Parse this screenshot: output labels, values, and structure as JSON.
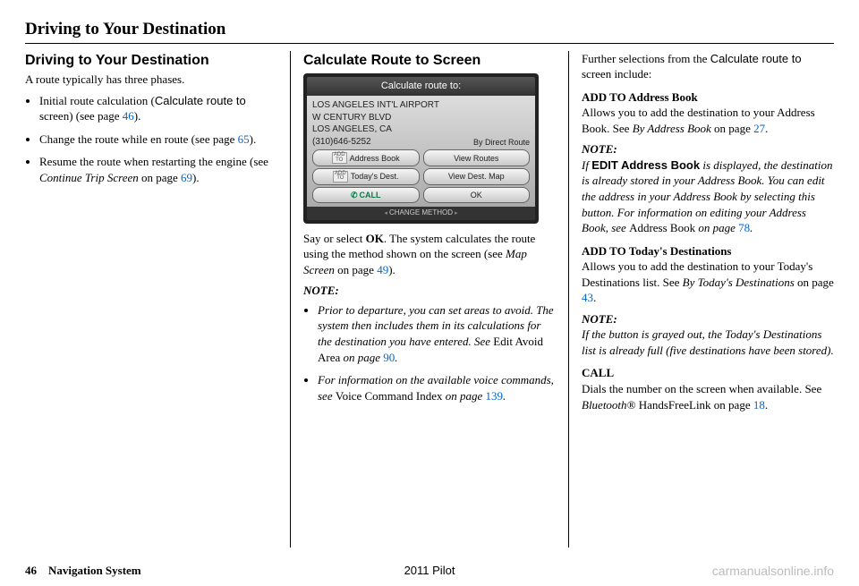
{
  "page_title": "Driving to Your Destination",
  "col1": {
    "h": "Driving to Your Destination",
    "p1": "A route typically has three phases.",
    "b1a": "Initial route calculation (",
    "b1b": "Calculate route to",
    "b1c": " screen) (see page ",
    "b1d": "46",
    "b1e": ").",
    "b2a": "Change the route while en route (see page ",
    "b2b": "65",
    "b2c": ").",
    "b3a": "Resume the route when restarting the engine (see ",
    "b3b": "Continue Trip Screen",
    "b3c": " on page ",
    "b3d": "69",
    "b3e": ")."
  },
  "col2": {
    "h": "Calculate Route to Screen",
    "ss_title": "Calculate route to:",
    "ss_l1": "LOS ANGELES INT'L AIRPORT",
    "ss_l2": "W CENTURY BLVD",
    "ss_l3": "LOS ANGELES, CA",
    "ss_l4": "(310)646-5252",
    "ss_route": "By Direct Route",
    "ss_b1": "Address Book",
    "ss_b2": "View Routes",
    "ss_b3": "Today's Dest.",
    "ss_b4": "View Dest. Map",
    "ss_b5": "CALL",
    "ss_b6": "OK",
    "ss_footer": "CHANGE METHOD",
    "p1a": "Say or select ",
    "p1b": "OK",
    "p1c": ". The system calculates the route using the method shown on the screen (see ",
    "p1d": "Map Screen",
    "p1e": " on page ",
    "p1f": "49",
    "p1g": ").",
    "note": "NOTE:",
    "n1a": "Prior to departure, you can set areas to avoid. The system then includes them in its calculations for the destination you have entered. See ",
    "n1b": "Edit Avoid Area",
    "n1c": " on page ",
    "n1d": "90",
    "n1e": ".",
    "n2a": "For information on the available voice commands, see ",
    "n2b": "Voice Command Index",
    "n2c": " on page ",
    "n2d": "139",
    "n2e": "."
  },
  "col3": {
    "p0a": "Further selections from the ",
    "p0b": "Calculate route to",
    "p0c": " screen include:",
    "h1": "ADD TO Address Book",
    "p1a": "Allows you to add the destination to your Address Book. See ",
    "p1b": "By Address Book",
    "p1c": " on page ",
    "p1d": "27",
    "p1e": ".",
    "note1": "NOTE:",
    "n1a": "If ",
    "n1b": "EDIT Address Book",
    "n1c": " is displayed, the destination is already stored in your Address Book. You can edit the address in your Address Book by selecting this button. For information on editing your Address Book, see ",
    "n1d": "Address Book",
    "n1e": " on page ",
    "n1f": "78",
    "n1g": ".",
    "h2": "ADD TO Today's Destinations",
    "p2a": "Allows you to add the destination to your Today's Destinations list. See ",
    "p2b": "By Today's Destinations",
    "p2c": " on page ",
    "p2d": "43",
    "p2e": ".",
    "note2": "NOTE:",
    "n2": "If the button is grayed out, the Today's Destinations list is already full (five destinations have been stored).",
    "h3": "CALL",
    "p3a": "Dials the number on the screen when available. See ",
    "p3b": "Bluetooth® ",
    "p3c": "HandsFreeLink on page ",
    "p3d": "18",
    "p3e": "."
  },
  "footer": {
    "pagenum": "46",
    "label": "Navigation System",
    "center": "2011 Pilot",
    "right": "carmanualsonline.info"
  }
}
